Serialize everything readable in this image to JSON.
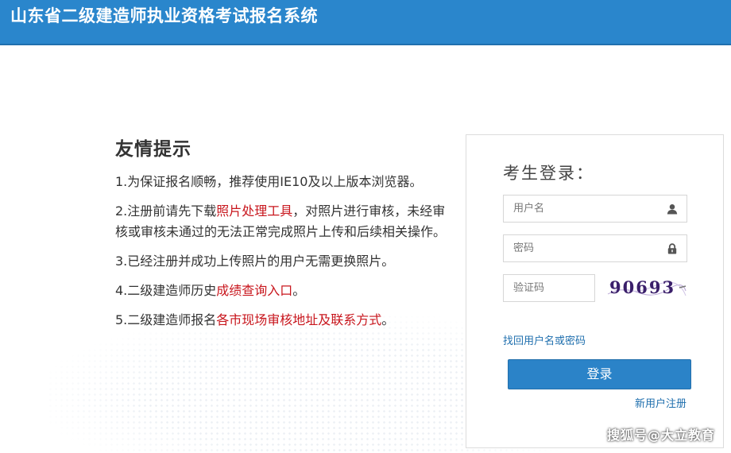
{
  "header": {
    "title": "山东省二级建造师执业资格考试报名系统",
    "bg_color": "#2a86cc"
  },
  "tips": {
    "heading": "友情提示",
    "items": [
      {
        "text": "1.为保证报名顺畅，推荐使用IE10及以上版本浏览器。"
      },
      {
        "before": "2.注册前请先下载",
        "link": "照片处理工具",
        "after": "，对照片进行审核，未经审核或审核未通过的无法正常完成照片上传和后续相关操作。"
      },
      {
        "text": "3.已经注册并成功上传照片的用户无需更换照片。"
      },
      {
        "before": "4.二级建造师历史",
        "link": "成绩查询入口",
        "after": "。"
      },
      {
        "before": "5.二级建造师报名",
        "link": "各市现场审核地址及联系方式",
        "after": "。"
      }
    ],
    "link_color": "#c8161d"
  },
  "login": {
    "title": "考生登录：",
    "username_placeholder": "用户名",
    "password_placeholder": "密码",
    "captcha_placeholder": "验证码",
    "captcha_text": "90693",
    "forgot_link": "找回用户名或密码",
    "submit_label": "登录",
    "register_link": "新用户注册",
    "icons": {
      "username": "user-icon",
      "password": "lock-icon"
    },
    "button_color": "#2b83c8"
  },
  "watermark": "搜狐号@大立教育"
}
